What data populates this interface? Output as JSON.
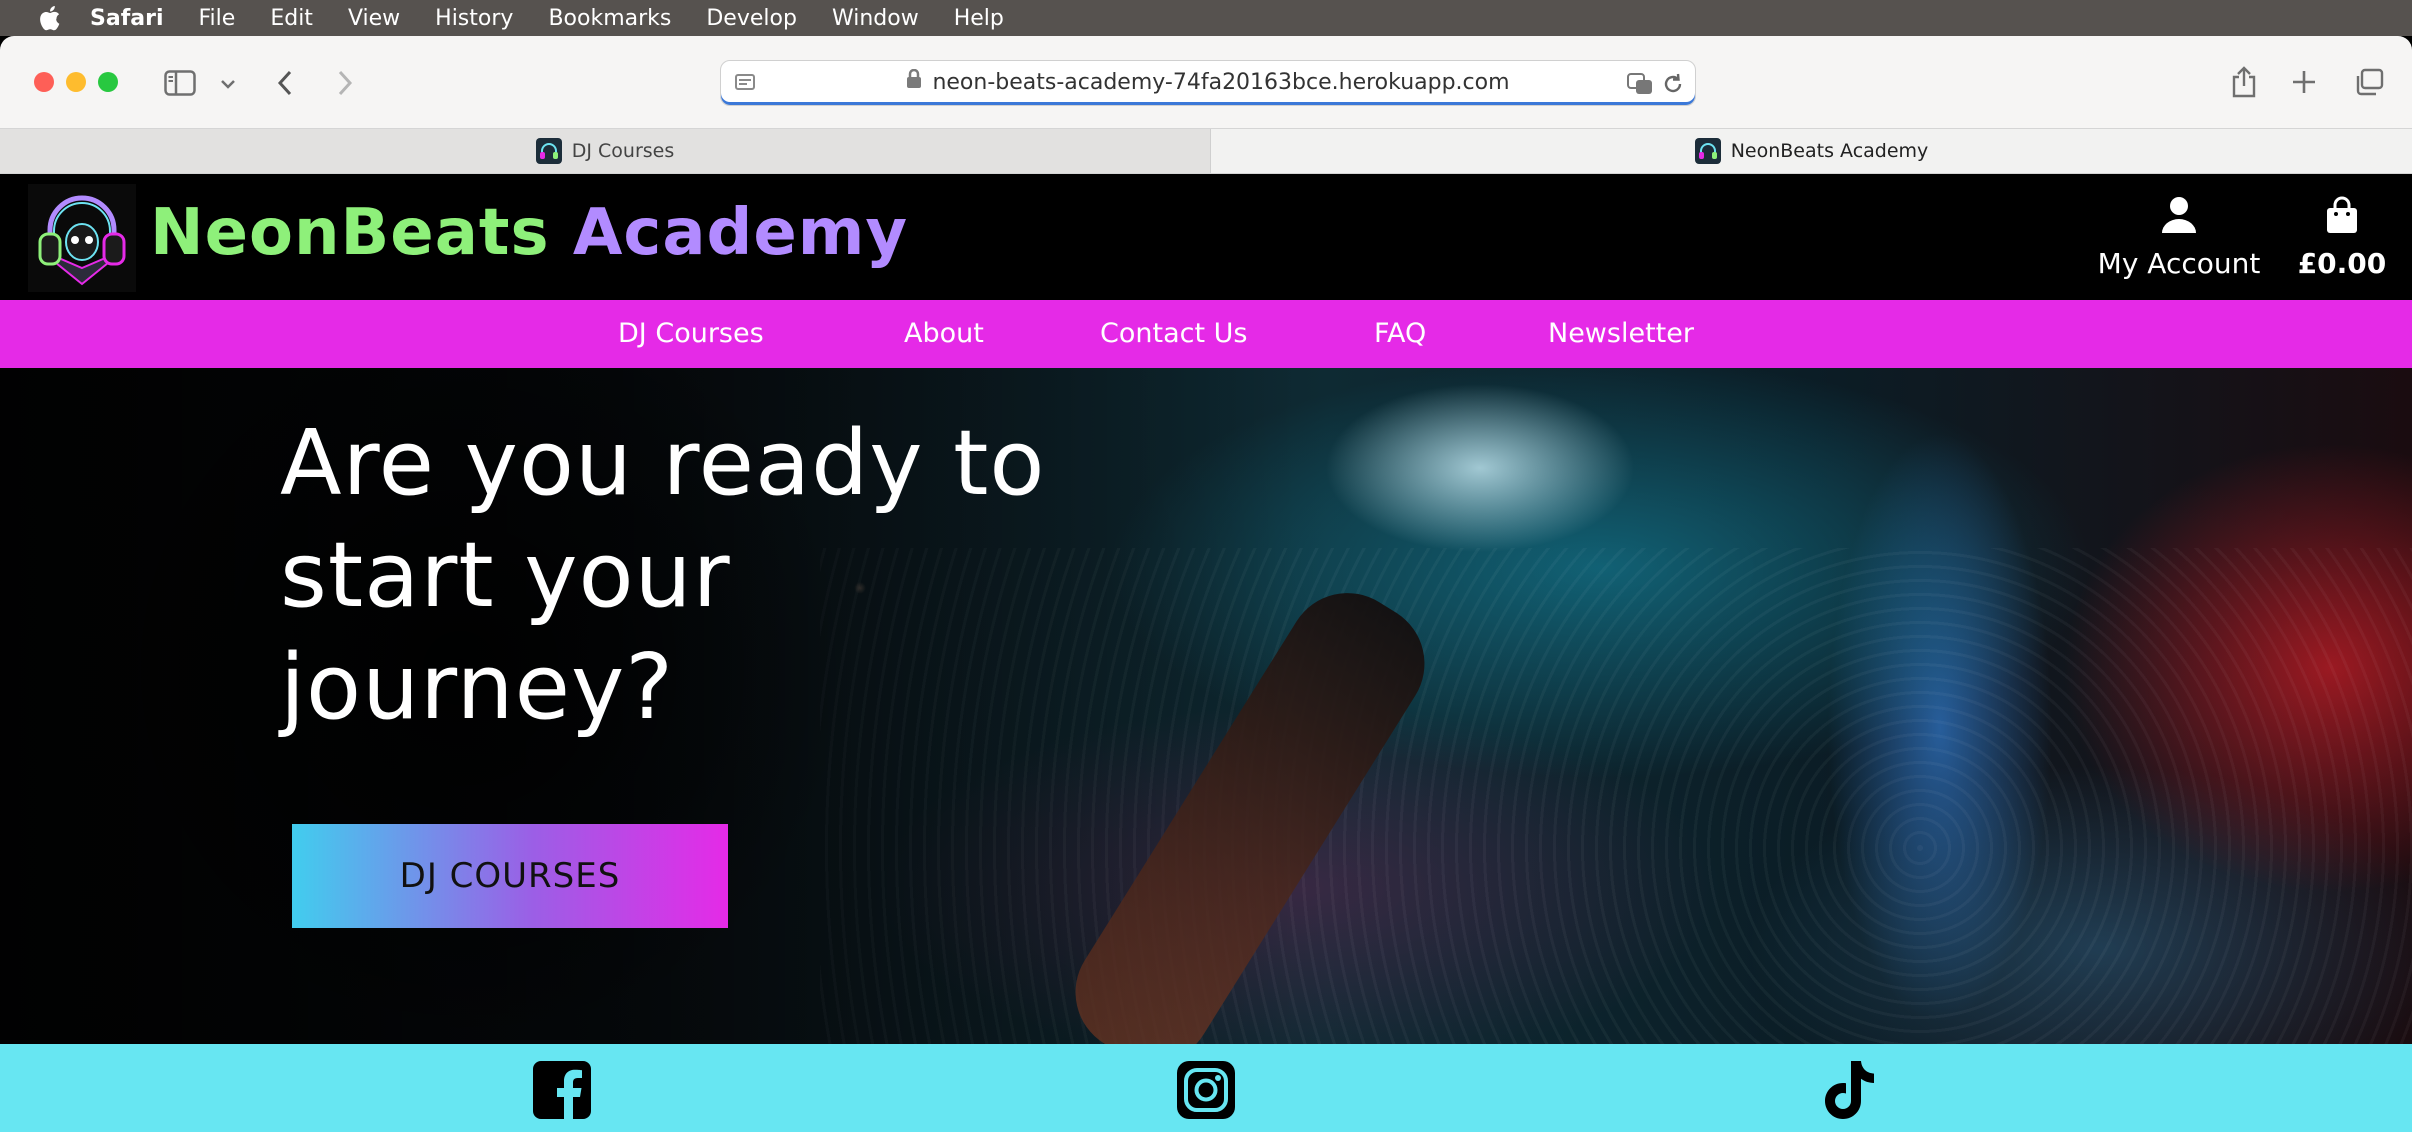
{
  "menubar": {
    "items": [
      "Safari",
      "File",
      "Edit",
      "View",
      "History",
      "Bookmarks",
      "Develop",
      "Window",
      "Help"
    ]
  },
  "browser": {
    "url": "neon-beats-academy-74fa20163bce.herokuapp.com",
    "tabs": [
      {
        "title": "DJ Courses"
      },
      {
        "title": "NeonBeats Academy"
      }
    ]
  },
  "site": {
    "title_part1": "NeonBeats",
    "title_part2": "Academy",
    "account_label": "My Account",
    "bag_total": "£0.00",
    "nav": [
      "DJ Courses",
      "About",
      "Contact Us",
      "FAQ",
      "Newsletter"
    ],
    "hero": {
      "line1": "Are you ready to",
      "line2": "start your",
      "line3": "journey?",
      "cta": "DJ COURSES"
    },
    "social": [
      "facebook-icon",
      "instagram-icon",
      "tiktok-icon"
    ]
  },
  "colors": {
    "nav_bg": "#e52ae7",
    "social_bg": "#67e6f2",
    "title_green": "#8ef07a",
    "title_purple": "#b28bff"
  }
}
